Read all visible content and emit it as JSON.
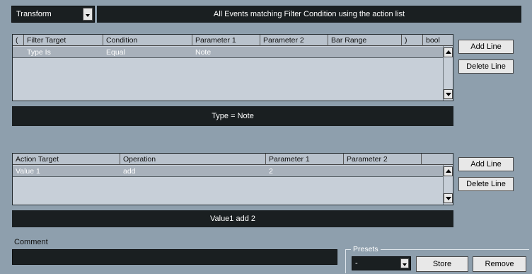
{
  "header": {
    "mode_value": "Transform",
    "description": "All Events matching Filter Condition using the action list"
  },
  "filter": {
    "columns": [
      "(",
      "Filter Target",
      "Condition",
      "Parameter 1",
      "Parameter 2",
      "Bar Range",
      ")",
      "bool"
    ],
    "rows": [
      {
        "paren_open": "",
        "target": "Type Is",
        "condition": "Equal",
        "param1": "Note",
        "param2": "",
        "bar_range": "",
        "paren_close": "",
        "bool": ""
      }
    ],
    "summary": "Type = Note",
    "add_label": "Add Line",
    "delete_label": "Delete Line"
  },
  "action": {
    "columns": [
      "Action Target",
      "Operation",
      "Parameter 1",
      "Parameter 2"
    ],
    "rows": [
      {
        "target": "Value 1",
        "operation": "add",
        "param1": "2",
        "param2": ""
      }
    ],
    "summary": "Value1 add 2",
    "add_label": "Add Line",
    "delete_label": "Delete Line"
  },
  "comment": {
    "label": "Comment",
    "value": ""
  },
  "presets": {
    "legend": "Presets",
    "selected": "-",
    "store_label": "Store",
    "remove_label": "Remove"
  },
  "colors": {
    "background": "#8e9fad",
    "dark_bar": "#1a1f21",
    "table_bg": "#c7cfd8",
    "selected_row": "#a8b1bb"
  }
}
